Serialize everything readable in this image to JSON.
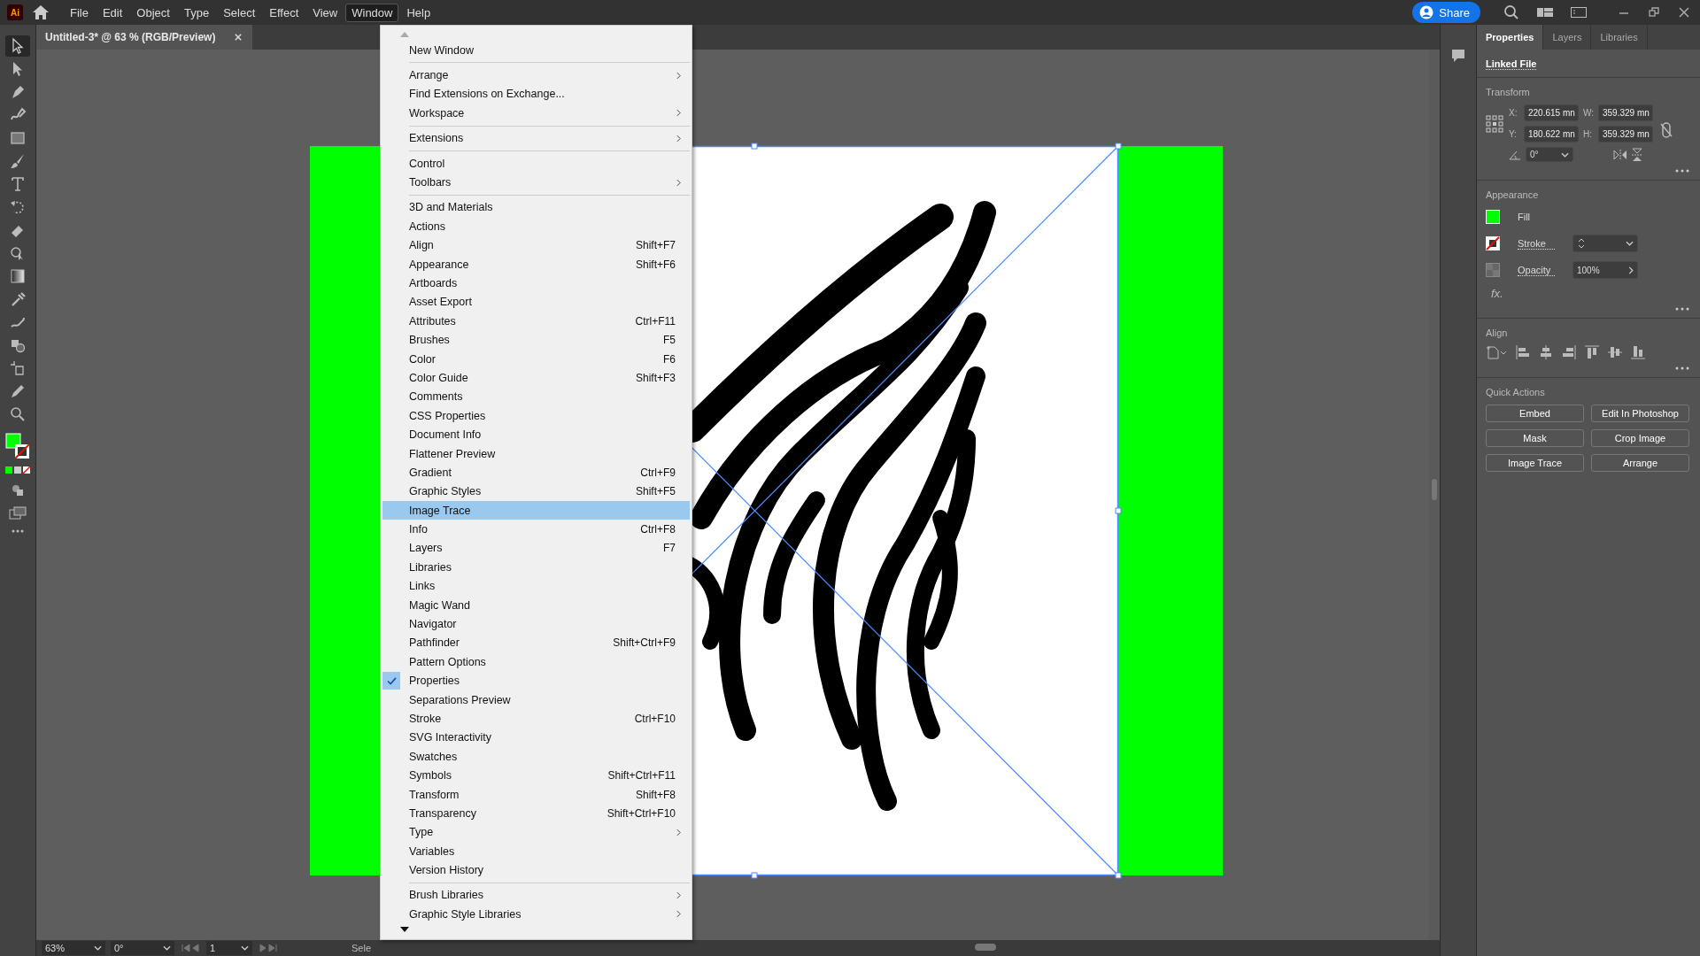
{
  "app_logo": "Ai",
  "menubar": {
    "items": [
      {
        "label": "File",
        "selected": false
      },
      {
        "label": "Edit",
        "selected": false
      },
      {
        "label": "Object",
        "selected": false
      },
      {
        "label": "Type",
        "selected": false
      },
      {
        "label": "Select",
        "selected": false
      },
      {
        "label": "Effect",
        "selected": false
      },
      {
        "label": "View",
        "selected": false
      },
      {
        "label": "Window",
        "selected": true
      },
      {
        "label": "Help",
        "selected": false
      }
    ]
  },
  "share_button": "Share",
  "document_tab": {
    "title": "Untitled-3* @ 63 % (RGB/Preview)"
  },
  "toolbar": {
    "tools": [
      {
        "selected": true
      },
      {
        "selected": false
      },
      {
        "selected": false
      },
      {
        "selected": false
      },
      {
        "selected": false
      },
      {
        "selected": false
      },
      {
        "selected": false
      },
      {
        "selected": false
      },
      {
        "selected": false
      },
      {
        "selected": false
      },
      {
        "selected": false
      },
      {
        "selected": false
      },
      {
        "selected": false
      },
      {
        "selected": false
      },
      {
        "selected": false
      },
      {
        "selected": false
      },
      {
        "selected": false
      }
    ]
  },
  "window_menu": {
    "items": [
      {
        "kind": "item",
        "label": "New Window",
        "submenu": false,
        "selected": false,
        "checked": false
      },
      {
        "kind": "separator"
      },
      {
        "kind": "item",
        "label": "Arrange",
        "submenu": true,
        "selected": false,
        "checked": false
      },
      {
        "kind": "item",
        "label": "Find Extensions on Exchange...",
        "submenu": false,
        "selected": false,
        "checked": false
      },
      {
        "kind": "item",
        "label": "Workspace",
        "submenu": true,
        "selected": false,
        "checked": false
      },
      {
        "kind": "separator"
      },
      {
        "kind": "item",
        "label": "Extensions",
        "submenu": true,
        "selected": false,
        "checked": false
      },
      {
        "kind": "separator"
      },
      {
        "kind": "item",
        "label": "Control",
        "submenu": false,
        "selected": false,
        "checked": false
      },
      {
        "kind": "item",
        "label": "Toolbars",
        "submenu": true,
        "selected": false,
        "checked": false
      },
      {
        "kind": "separator"
      },
      {
        "kind": "item",
        "label": "3D and Materials",
        "submenu": false,
        "selected": false,
        "checked": false
      },
      {
        "kind": "item",
        "label": "Actions",
        "submenu": false,
        "selected": false,
        "checked": false
      },
      {
        "kind": "item",
        "label": "Align",
        "shortcut": "Shift+F7",
        "submenu": false,
        "selected": false,
        "checked": false
      },
      {
        "kind": "item",
        "label": "Appearance",
        "shortcut": "Shift+F6",
        "submenu": false,
        "selected": false,
        "checked": false
      },
      {
        "kind": "item",
        "label": "Artboards",
        "submenu": false,
        "selected": false,
        "checked": false
      },
      {
        "kind": "item",
        "label": "Asset Export",
        "submenu": false,
        "selected": false,
        "checked": false
      },
      {
        "kind": "item",
        "label": "Attributes",
        "shortcut": "Ctrl+F11",
        "submenu": false,
        "selected": false,
        "checked": false
      },
      {
        "kind": "item",
        "label": "Brushes",
        "shortcut": "F5",
        "submenu": false,
        "selected": false,
        "checked": false
      },
      {
        "kind": "item",
        "label": "Color",
        "shortcut": "F6",
        "submenu": false,
        "selected": false,
        "checked": false
      },
      {
        "kind": "item",
        "label": "Color Guide",
        "shortcut": "Shift+F3",
        "submenu": false,
        "selected": false,
        "checked": false
      },
      {
        "kind": "item",
        "label": "Comments",
        "submenu": false,
        "selected": false,
        "checked": false
      },
      {
        "kind": "item",
        "label": "CSS Properties",
        "submenu": false,
        "selected": false,
        "checked": false
      },
      {
        "kind": "item",
        "label": "Document Info",
        "submenu": false,
        "selected": false,
        "checked": false
      },
      {
        "kind": "item",
        "label": "Flattener Preview",
        "submenu": false,
        "selected": false,
        "checked": false
      },
      {
        "kind": "item",
        "label": "Gradient",
        "shortcut": "Ctrl+F9",
        "submenu": false,
        "selected": false,
        "checked": false
      },
      {
        "kind": "item",
        "label": "Graphic Styles",
        "shortcut": "Shift+F5",
        "submenu": false,
        "selected": false,
        "checked": false
      },
      {
        "kind": "item",
        "label": "Image Trace",
        "submenu": false,
        "selected": true,
        "checked": false
      },
      {
        "kind": "item",
        "label": "Info",
        "shortcut": "Ctrl+F8",
        "submenu": false,
        "selected": false,
        "checked": false
      },
      {
        "kind": "item",
        "label": "Layers",
        "shortcut": "F7",
        "submenu": false,
        "selected": false,
        "checked": false
      },
      {
        "kind": "item",
        "label": "Libraries",
        "submenu": false,
        "selected": false,
        "checked": false
      },
      {
        "kind": "item",
        "label": "Links",
        "submenu": false,
        "selected": false,
        "checked": false
      },
      {
        "kind": "item",
        "label": "Magic Wand",
        "submenu": false,
        "selected": false,
        "checked": false
      },
      {
        "kind": "item",
        "label": "Navigator",
        "submenu": false,
        "selected": false,
        "checked": false
      },
      {
        "kind": "item",
        "label": "Pathfinder",
        "shortcut": "Shift+Ctrl+F9",
        "submenu": false,
        "selected": false,
        "checked": false
      },
      {
        "kind": "item",
        "label": "Pattern Options",
        "submenu": false,
        "selected": false,
        "checked": false
      },
      {
        "kind": "item",
        "label": "Properties",
        "submenu": false,
        "selected": false,
        "checked": true
      },
      {
        "kind": "item",
        "label": "Separations Preview",
        "submenu": false,
        "selected": false,
        "checked": false
      },
      {
        "kind": "item",
        "label": "Stroke",
        "shortcut": "Ctrl+F10",
        "submenu": false,
        "selected": false,
        "checked": false
      },
      {
        "kind": "item",
        "label": "SVG Interactivity",
        "submenu": false,
        "selected": false,
        "checked": false
      },
      {
        "kind": "item",
        "label": "Swatches",
        "submenu": false,
        "selected": false,
        "checked": false
      },
      {
        "kind": "item",
        "label": "Symbols",
        "shortcut": "Shift+Ctrl+F11",
        "submenu": false,
        "selected": false,
        "checked": false
      },
      {
        "kind": "item",
        "label": "Transform",
        "shortcut": "Shift+F8",
        "submenu": false,
        "selected": false,
        "checked": false
      },
      {
        "kind": "item",
        "label": "Transparency",
        "shortcut": "Shift+Ctrl+F10",
        "submenu": false,
        "selected": false,
        "checked": false
      },
      {
        "kind": "item",
        "label": "Type",
        "submenu": true,
        "selected": false,
        "checked": false
      },
      {
        "kind": "item",
        "label": "Variables",
        "submenu": false,
        "selected": false,
        "checked": false
      },
      {
        "kind": "item",
        "label": "Version History",
        "submenu": false,
        "selected": false,
        "checked": false
      },
      {
        "kind": "separator"
      },
      {
        "kind": "item",
        "label": "Brush Libraries",
        "submenu": true,
        "selected": false,
        "checked": false
      },
      {
        "kind": "item",
        "label": "Graphic Style Libraries",
        "submenu": true,
        "selected": false,
        "checked": false
      }
    ]
  },
  "properties_panel": {
    "tabs": [
      {
        "label": "Properties",
        "selected": true
      },
      {
        "label": "Layers",
        "selected": false
      },
      {
        "label": "Libraries",
        "selected": false
      }
    ],
    "linked_file": "Linked File",
    "transform": {
      "title": "Transform",
      "x_label": "X:",
      "x": "220.615 mn",
      "w_label": "W:",
      "w": "359.329 mn",
      "y_label": "Y:",
      "y": "180.622 mn",
      "h_label": "H:",
      "h": "359.329 mn",
      "angle": "0°"
    },
    "appearance": {
      "title": "Appearance",
      "fill": "Fill",
      "stroke": "Stroke",
      "opacity_label": "Opacity",
      "opacity": "100%",
      "fx": "fx."
    },
    "align": {
      "title": "Align"
    },
    "quick_actions": {
      "title": "Quick Actions",
      "buttons": [
        "Embed",
        "Edit In Photoshop",
        "Mask",
        "Crop Image",
        "Image Trace",
        "Arrange"
      ]
    }
  },
  "status_bar": {
    "zoom": "63%",
    "rotation": "0°",
    "artboard": "1",
    "info": "Sele"
  }
}
